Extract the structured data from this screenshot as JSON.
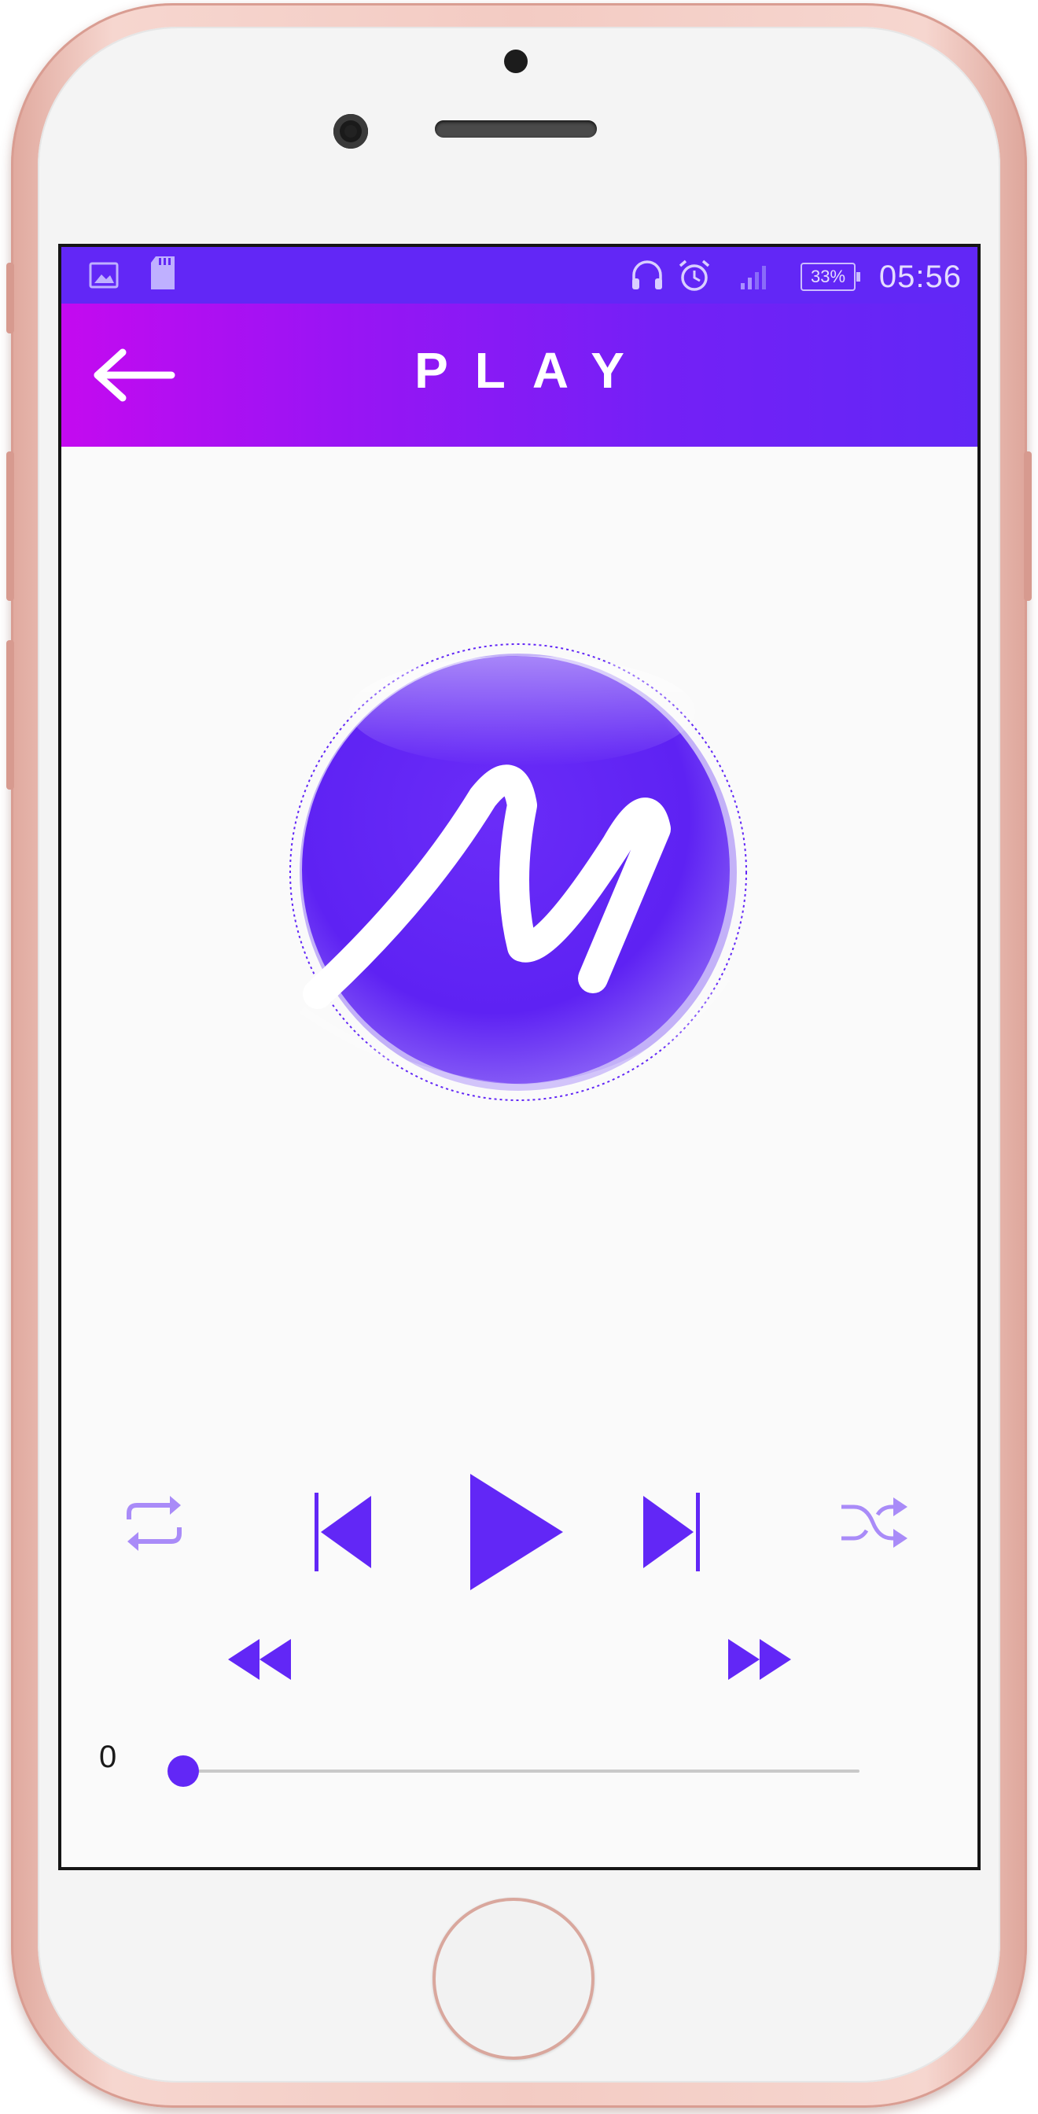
{
  "statusbar": {
    "time": "05:56",
    "battery": "33%",
    "icons": [
      "image-icon",
      "sd-card-icon",
      "headphones-icon",
      "alarm-icon",
      "signal-icon",
      "battery-icon"
    ]
  },
  "toolbar": {
    "title": "PLAY",
    "back_icon": "arrow-left-icon"
  },
  "album_art": {
    "logo_letter": "M",
    "color": "#6227f6"
  },
  "controls": {
    "repeat_icon": "repeat-icon",
    "previous_icon": "skip-previous-icon",
    "play_icon": "play-icon",
    "next_icon": "skip-next-icon",
    "shuffle_icon": "shuffle-icon",
    "rewind_icon": "rewind-icon",
    "fast_forward_icon": "fast-forward-icon"
  },
  "progress": {
    "current_time": "0",
    "fraction": 0
  },
  "colors": {
    "accent": "#6227f6",
    "accent_light": "#a98bf8",
    "toolbar_start": "#c40af0",
    "toolbar_end": "#6227f6",
    "phone_frame": "#f3cbc3"
  }
}
